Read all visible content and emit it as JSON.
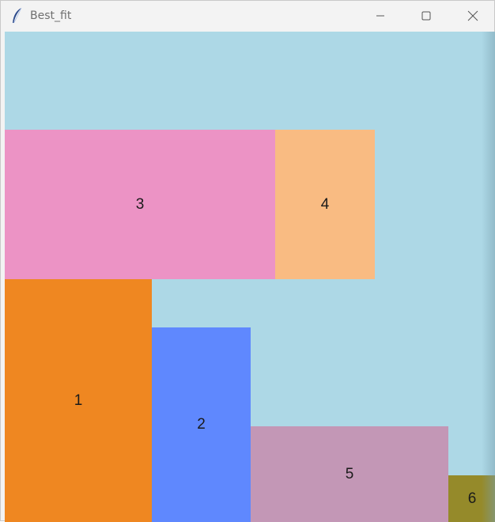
{
  "window": {
    "title": "Best_fit",
    "icon": "feather-icon",
    "controls": {
      "minimize_icon": "minimize-icon",
      "maximize_icon": "maximize-icon",
      "close_icon": "close-icon"
    }
  },
  "canvas": {
    "background": "#add8e6",
    "blocks": [
      {
        "label": "3",
        "color": "#ec93c5"
      },
      {
        "label": "4",
        "color": "#f9bb82"
      },
      {
        "label": "1",
        "color": "#ef8721"
      },
      {
        "label": "2",
        "color": "#5f88fe"
      },
      {
        "label": "5",
        "color": "#c397b6"
      },
      {
        "label": "6",
        "color": "#958a2a"
      }
    ]
  }
}
